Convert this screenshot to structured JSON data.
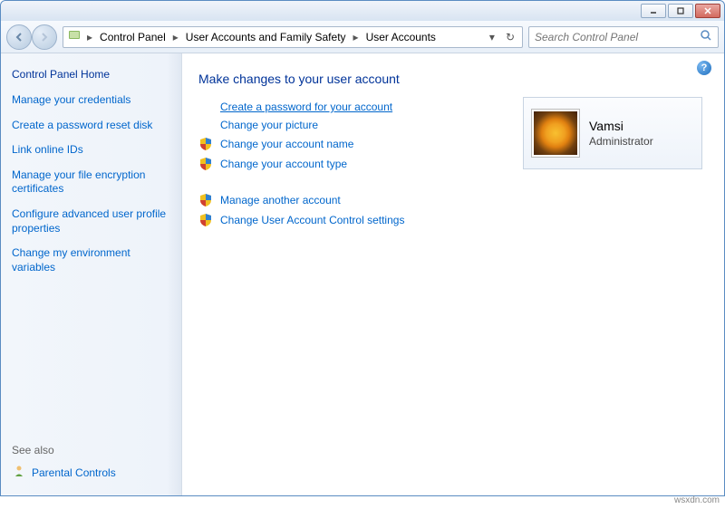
{
  "titlebar": {
    "min_icon": "minimize-icon",
    "max_icon": "maximize-icon",
    "close_icon": "close-icon"
  },
  "breadcrumbs": {
    "root": "Control Panel",
    "mid": "User Accounts and Family Safety",
    "leaf": "User Accounts"
  },
  "search": {
    "placeholder": "Search Control Panel"
  },
  "sidebar": {
    "home": "Control Panel Home",
    "links": [
      "Manage your credentials",
      "Create a password reset disk",
      "Link online IDs",
      "Manage your file encryption certificates",
      "Configure advanced user profile properties",
      "Change my environment variables"
    ],
    "seealso": "See also",
    "parental": "Parental Controls"
  },
  "main": {
    "title": "Make changes to your user account",
    "links": {
      "create_pw": "Create a password for your account",
      "change_pic": "Change your picture",
      "change_name": "Change your account name",
      "change_type": "Change your account type",
      "manage_other": "Manage another account",
      "uac": "Change User Account Control settings"
    }
  },
  "user": {
    "name": "Vamsi",
    "role": "Administrator"
  },
  "watermark": "wsxdn.com"
}
